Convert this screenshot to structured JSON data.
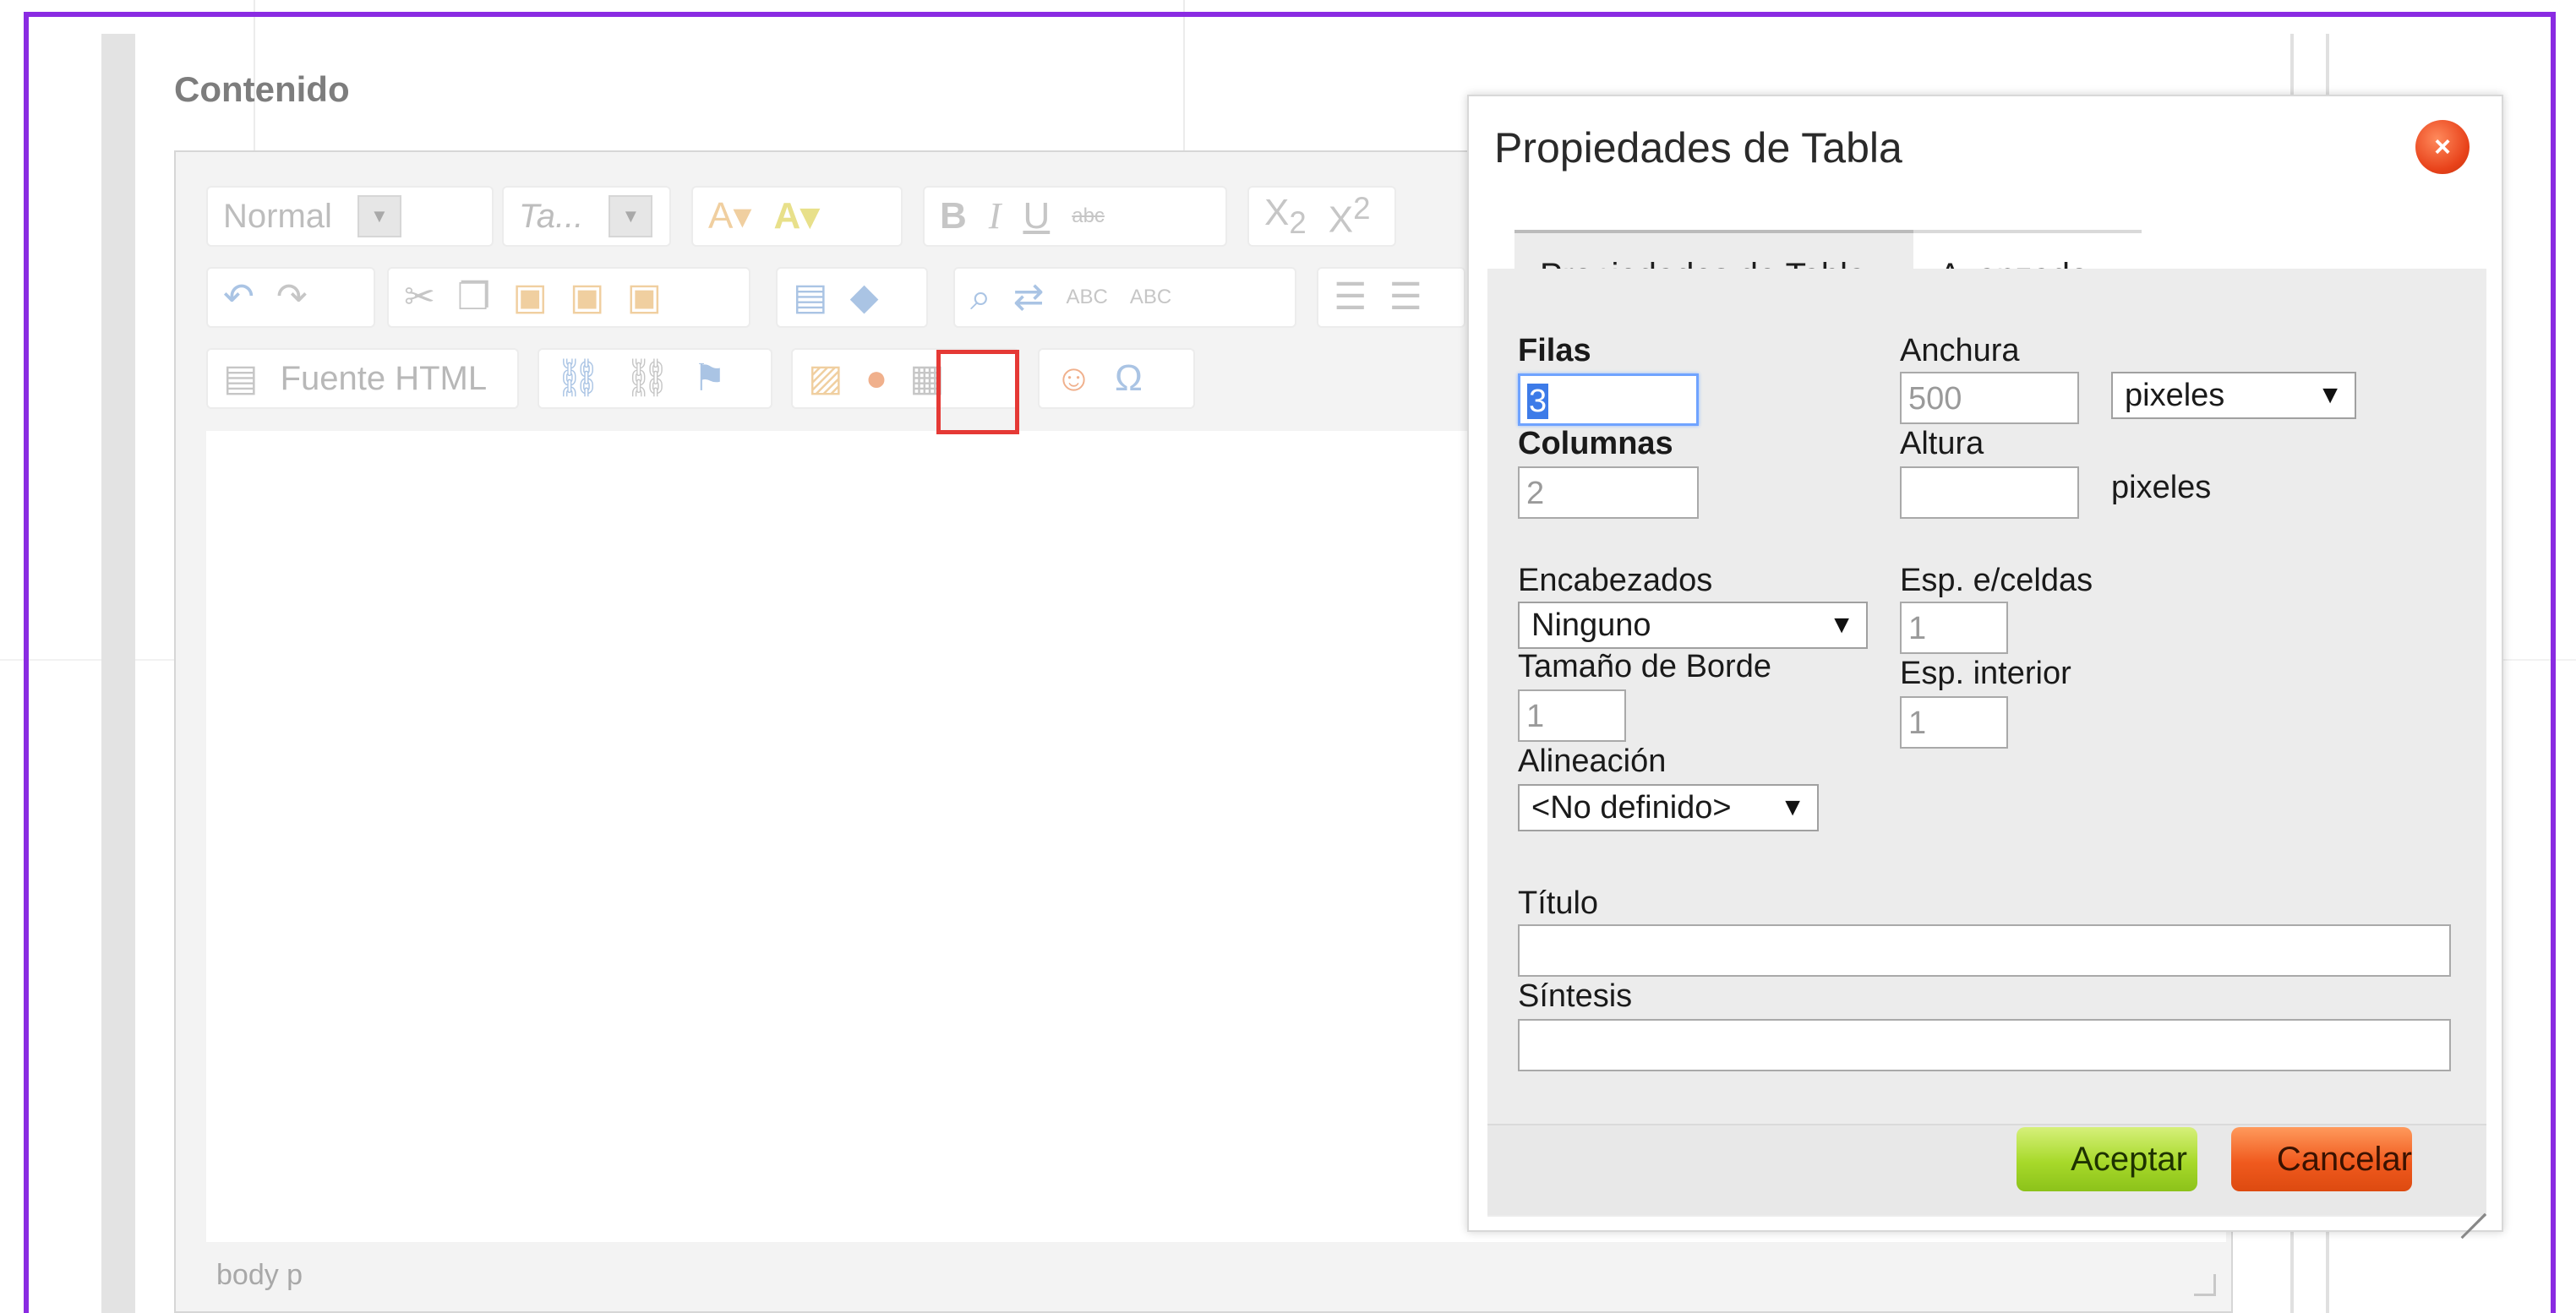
{
  "section": {
    "title": "Contenido"
  },
  "toolbar": {
    "format_combo": "Normal",
    "size_combo": "Ta...",
    "bold": "B",
    "italic": "I",
    "underline": "U",
    "strike": "abc",
    "subscript": "X",
    "subscript_mark": "2",
    "superscript": "X",
    "superscript_mark": "2",
    "source_label": "Fuente HTML",
    "special_char": "Ω",
    "abc1": "ABC",
    "abc2": "ABC"
  },
  "editor": {
    "path": "body  p"
  },
  "dialog": {
    "title": "Propiedades de Tabla",
    "close_glyph": "×",
    "tabs": [
      {
        "label": "Propiedades de Tabla",
        "active": true
      },
      {
        "label": "Avanzado",
        "active": false
      }
    ],
    "fields": {
      "rows_label": "Filas",
      "rows_value": "3",
      "cols_label": "Columnas",
      "cols_value": "2",
      "width_label": "Anchura",
      "width_value": "500",
      "width_unit": "pixeles",
      "height_label": "Altura",
      "height_value": "",
      "height_unit": "pixeles",
      "headers_label": "Encabezados",
      "headers_value": "Ninguno",
      "cellspacing_label": "Esp. e/celdas",
      "cellspacing_value": "1",
      "border_label": "Tamaño de Borde",
      "border_value": "1",
      "cellpadding_label": "Esp. interior",
      "cellpadding_value": "1",
      "align_label": "Alineación",
      "align_value": "<No definido>",
      "caption_label": "Título",
      "caption_value": "",
      "summary_label": "Síntesis",
      "summary_value": ""
    },
    "buttons": {
      "accept": "Aceptar",
      "cancel": "Cancelar"
    },
    "select_arrow": "▼"
  },
  "colors": {
    "frame": "#8a2be2",
    "highlight": "#e53935",
    "accept_green": "#a7d92a",
    "cancel_orange": "#f05a1e",
    "close_red": "#e8421a"
  }
}
